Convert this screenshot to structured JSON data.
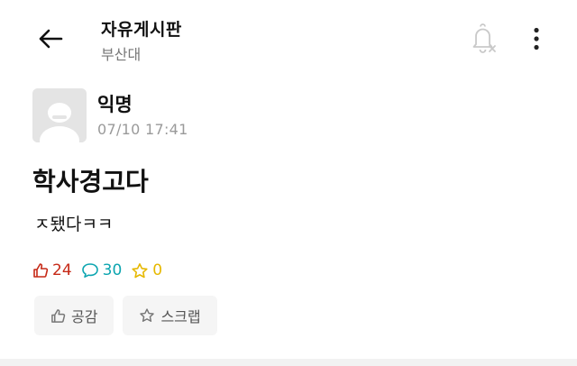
{
  "header": {
    "title": "자유게시판",
    "subtitle": "부산대",
    "icons": {
      "back": "arrow-left-icon",
      "notify": "bell-off-icon",
      "more": "more-vertical-icon"
    }
  },
  "post": {
    "author": "익명",
    "time": "07/10 17:41",
    "title": "학사경고다",
    "body": "ㅈ됐다ㅋㅋ"
  },
  "stats": {
    "likes": "24",
    "comments": "30",
    "scraps": "0"
  },
  "actions": {
    "like_label": "공감",
    "scrap_label": "스크랩"
  },
  "colors": {
    "like": "#c62917",
    "comment": "#0ca5b0",
    "scrap": "#e6b800",
    "muted": "#9a9a9a"
  }
}
